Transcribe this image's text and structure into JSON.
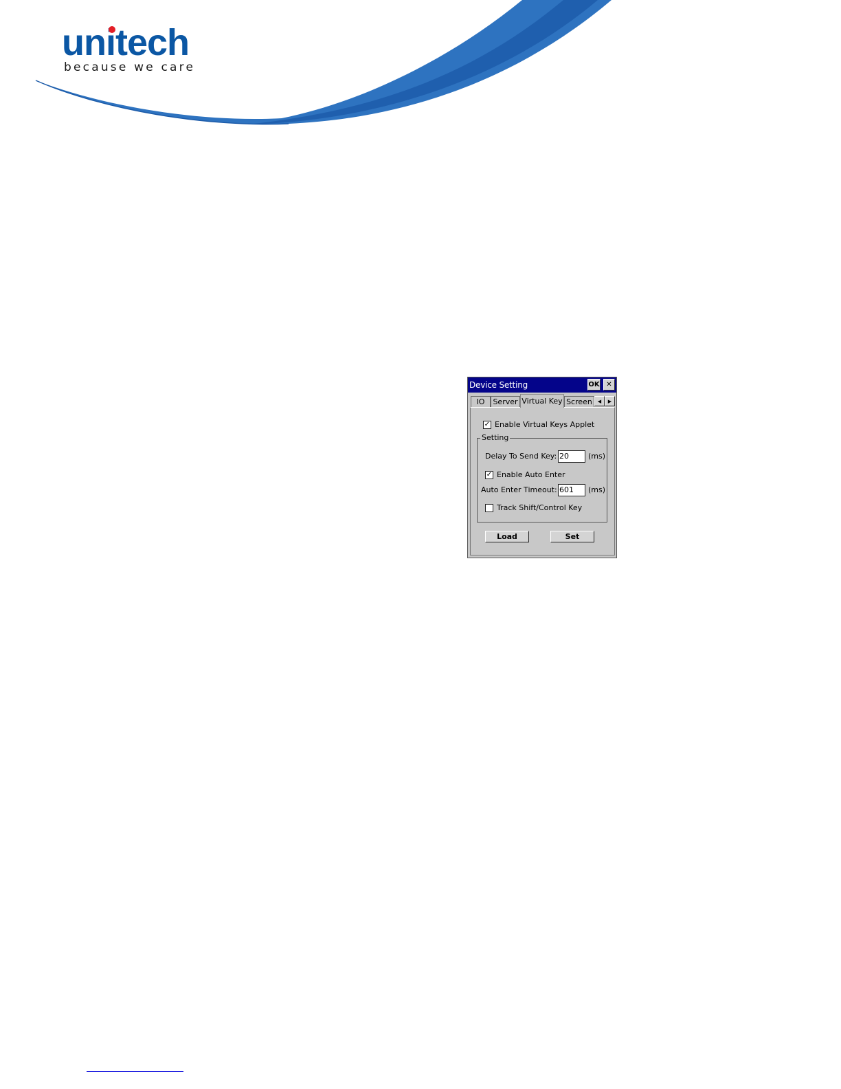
{
  "brand": {
    "name": "unitech",
    "tagline": "because we care",
    "accent": "#0b57a4",
    "dot_color": "#e41e26"
  },
  "dialog": {
    "title": "Device Setting",
    "ok_label": "OK",
    "close_icon": "close-icon",
    "tabs": [
      {
        "label": "IO"
      },
      {
        "label": "Server"
      },
      {
        "label": "Virtual Key",
        "active": true
      },
      {
        "label": "Screen"
      }
    ],
    "enable_virtual_keys": {
      "label": "Enable Virtual Keys Applet",
      "checked": true
    },
    "group_label": "Setting",
    "delay_to_send_key": {
      "label": "Delay To Send Key:",
      "value": "20",
      "unit": "(ms)"
    },
    "enable_auto_enter": {
      "label": "Enable Auto Enter",
      "checked": true
    },
    "auto_enter_timeout": {
      "label": "Auto Enter Timeout:",
      "value": "601",
      "unit": "(ms)"
    },
    "track_shift_control": {
      "label": "Track Shift/Control Key",
      "checked": false
    },
    "load_label": "Load",
    "set_label": "Set",
    "titlebar_color": "#04048a"
  }
}
